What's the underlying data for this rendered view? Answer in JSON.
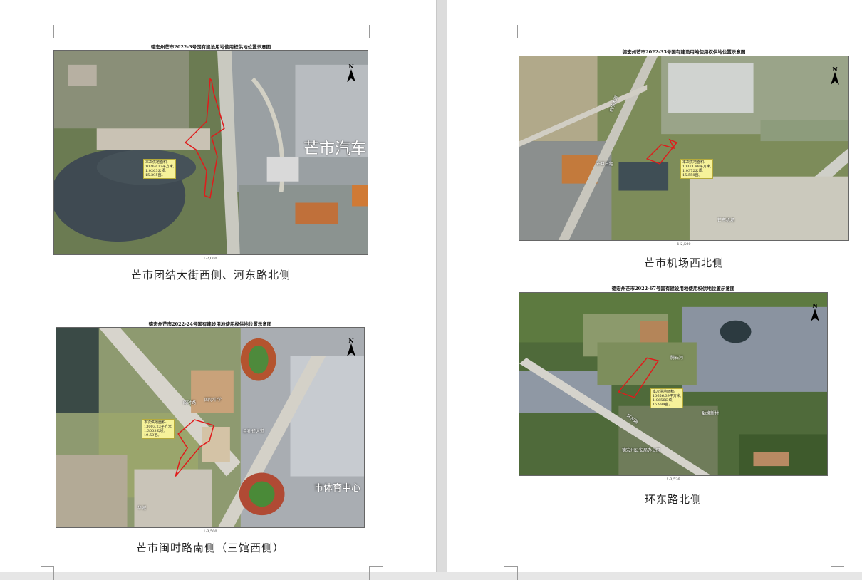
{
  "maps": {
    "m1": {
      "title": "德宏州芒市2022-3号国有建设用地使用权供地位置示意图",
      "scale": "1:2,000",
      "caption": "芒市团结大街西侧、河东路北侧",
      "callout": [
        "本次供地面积:",
        "10263.37平方米,",
        "1.0263公顷,",
        "15.395亩。"
      ],
      "labels": {
        "big": "芒市汽车"
      }
    },
    "m2": {
      "title": "德宏州芒市2022-24号国有建设用地使用权供地位置示意图",
      "scale": "1:3,500",
      "caption": "芒市闽时路南侧（三馆西侧）",
      "callout": [
        "本次供地面积:",
        "13003.23平方米,",
        "1.3003公顷,",
        "19.50亩。"
      ],
      "labels": {
        "road1": "闽时路",
        "school": "国际中学",
        "road2": "金孔雀大道",
        "stadium": "市体育中心",
        "city": "华城"
      }
    },
    "m3": {
      "title": "德宏州芒市2022-33号国有建设用地使用权供地位置示意图",
      "scale": "1:2,500",
      "caption": "芒市机场西北侧",
      "callout": [
        "本次供地面积:",
        "10371.98平方米,",
        "1.0372公顷,",
        "15.558亩。"
      ],
      "labels": {
        "road": "机场大道",
        "area": "芒市机场",
        "village": "芒旦三组"
      }
    },
    "m4": {
      "title": "德宏州芒市2022-67号国有建设用地使用权供地位置示意图",
      "scale": "1:3,526",
      "caption": "环东路北侧",
      "callout": [
        "本次供地面积:",
        "10656.39平方米,",
        "1.0656公顷,",
        "15.984亩。"
      ],
      "labels": {
        "village1": "腾石河",
        "road": "环东路",
        "village2": "勐焕新村",
        "office": "德宏州公安局办公区"
      }
    }
  },
  "north_label": "N",
  "colors": {
    "boundary": "#e01b1b",
    "callout_bg": "#f6f29a"
  }
}
